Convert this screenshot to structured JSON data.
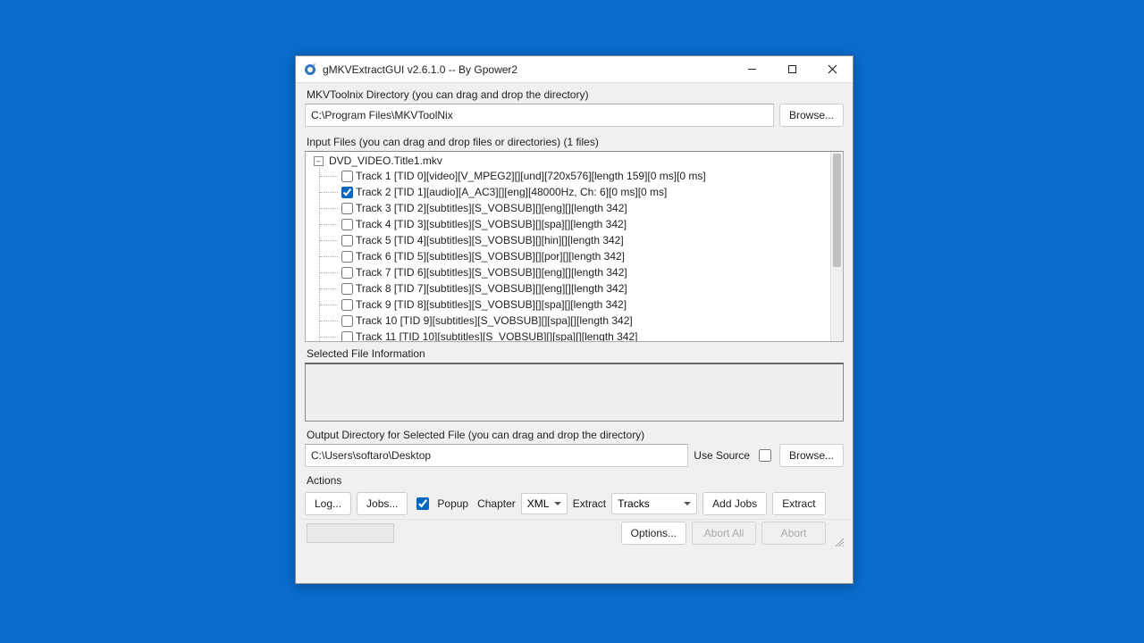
{
  "titlebar": {
    "title": "gMKVExtractGUI v2.6.1.0 -- By Gpower2"
  },
  "mkvtoolnix": {
    "label": "MKVToolnix Directory (you can drag and drop the directory)",
    "path": "C:\\Program Files\\MKVToolNix",
    "browse": "Browse..."
  },
  "input": {
    "label": "Input Files (you can drag and drop files or directories) (1 files)",
    "file": "DVD_VIDEO.Title1.mkv",
    "tracks": [
      {
        "label": "Track 1 [TID 0][video][V_MPEG2][][und][720x576][length 159][0 ms][0 ms]",
        "checked": false
      },
      {
        "label": "Track 2 [TID 1][audio][A_AC3][][eng][48000Hz, Ch: 6][0 ms][0 ms]",
        "checked": true
      },
      {
        "label": "Track 3 [TID 2][subtitles][S_VOBSUB][][eng][][length 342]",
        "checked": false
      },
      {
        "label": "Track 4 [TID 3][subtitles][S_VOBSUB][][spa][][length 342]",
        "checked": false
      },
      {
        "label": "Track 5 [TID 4][subtitles][S_VOBSUB][][hin][][length 342]",
        "checked": false
      },
      {
        "label": "Track 6 [TID 5][subtitles][S_VOBSUB][][por][][length 342]",
        "checked": false
      },
      {
        "label": "Track 7 [TID 6][subtitles][S_VOBSUB][][eng][][length 342]",
        "checked": false
      },
      {
        "label": "Track 8 [TID 7][subtitles][S_VOBSUB][][eng][][length 342]",
        "checked": false
      },
      {
        "label": "Track 9 [TID 8][subtitles][S_VOBSUB][][spa][][length 342]",
        "checked": false
      },
      {
        "label": "Track 10 [TID 9][subtitles][S_VOBSUB][][spa][][length 342]",
        "checked": false
      },
      {
        "label": "Track 11 [TID 10][subtitles][S_VOBSUB][][spa][][length 342]",
        "checked": false
      }
    ]
  },
  "selected_info": {
    "label": "Selected File Information"
  },
  "output": {
    "label": "Output Directory for Selected File (you can drag and drop the directory)",
    "path": "C:\\Users\\softaro\\Desktop",
    "use_source": "Use Source",
    "browse": "Browse..."
  },
  "actions": {
    "label": "Actions",
    "log": "Log...",
    "jobs": "Jobs...",
    "popup": "Popup",
    "chapter_label": "Chapter",
    "chapter_value": "XML",
    "extract_label": "Extract",
    "extract_value": "Tracks",
    "add_jobs": "Add Jobs",
    "extract": "Extract"
  },
  "footer": {
    "options": "Options...",
    "abort_all": "Abort All",
    "abort": "Abort"
  }
}
